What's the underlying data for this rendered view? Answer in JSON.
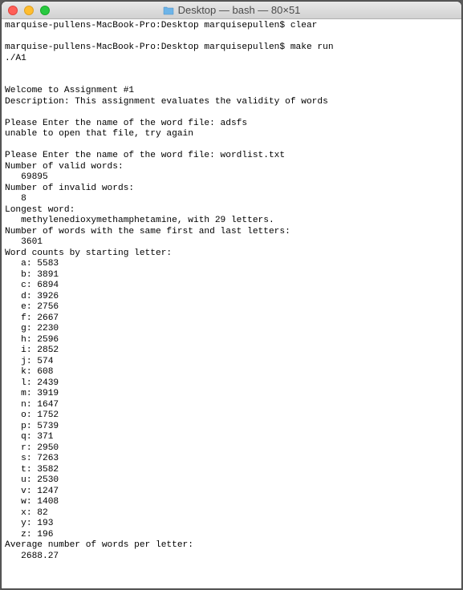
{
  "titlebar": {
    "title": "Desktop — bash — 80×51"
  },
  "terminal": {
    "prompt": "marquise-pullens-MacBook-Pro:Desktop marquisepullen$",
    "lines": {
      "cmd_clear": "clear",
      "cmd_make": "make run",
      "exec_a1": "./A1",
      "blank": "",
      "welcome": "Welcome to Assignment #1",
      "description": "Description: This assignment evaluates the validity of words",
      "prompt_enter": "Please Enter the name of the word file:",
      "bad_file": "adsfs",
      "unable": "unable to open that file, try again",
      "good_file": "wordlist.txt",
      "valid_label": "Number of valid words:",
      "valid_count": "69895",
      "invalid_label": "Number of invalid words:",
      "invalid_count": "8",
      "longest_label": "Longest word:",
      "longest_value": "methylenedioxymethamphetamine, with 29 letters.",
      "same_label": "Number of words with the same first and last letters:",
      "same_count": "3601",
      "counts_label": "Word counts by starting letter:",
      "avg_label": "Average number of words per letter:",
      "avg_value": "2688.27"
    },
    "letter_counts": [
      "a: 5583",
      "b: 3891",
      "c: 6894",
      "d: 3926",
      "e: 2756",
      "f: 2667",
      "g: 2230",
      "h: 2596",
      "i: 2852",
      "j: 574",
      "k: 608",
      "l: 2439",
      "m: 3919",
      "n: 1647",
      "o: 1752",
      "p: 5739",
      "q: 371",
      "r: 2950",
      "s: 7263",
      "t: 3582",
      "u: 2530",
      "v: 1247",
      "w: 1408",
      "x: 82",
      "y: 193",
      "z: 196"
    ]
  }
}
